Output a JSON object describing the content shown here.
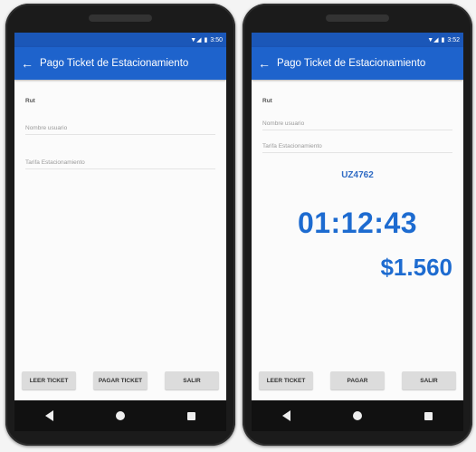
{
  "left": {
    "status_time": "3:50",
    "title": "Pago Ticket de Estacionamiento",
    "fields": {
      "rut": "Rut",
      "nombre": "Nombre usuario",
      "tarifa": "Tarifa Estacionamiento"
    },
    "buttons": {
      "leer": "LEER TICKET",
      "pagar": "PAGAR TICKET",
      "salir": "SALIR"
    }
  },
  "right": {
    "status_time": "3:52",
    "title": "Pago Ticket de Estacionamiento",
    "fields": {
      "rut": "Rut",
      "nombre": "Nombre usuario",
      "tarifa": "Tarifa Estacionamiento"
    },
    "plate": "UZ4762",
    "timer": "01:12:43",
    "amount": "$1.560",
    "buttons": {
      "leer": "LEER TICKET",
      "pagar": "PAGAR",
      "salir": "SALIR"
    }
  }
}
